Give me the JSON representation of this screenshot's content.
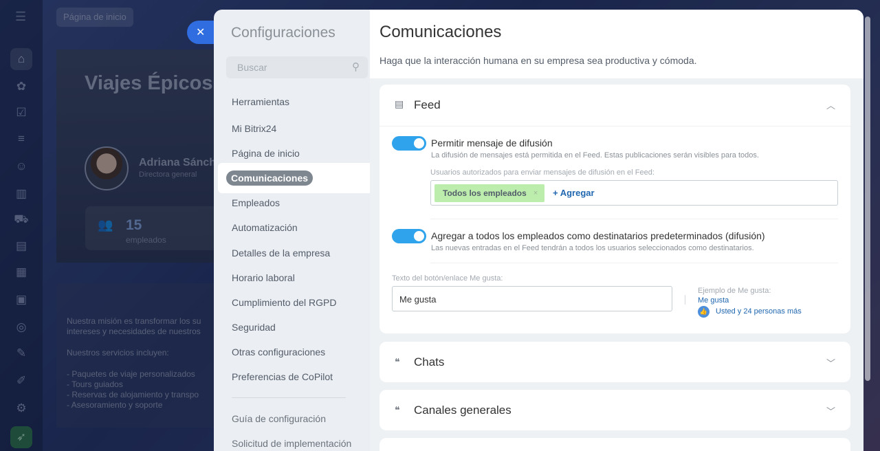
{
  "background": {
    "breadcrumb": "Página de inicio",
    "hero_title": "Viajes Épicos",
    "person_name": "Adriana Sánch",
    "person_role": "Directora general",
    "stat_number": "15",
    "stat_label": "empleados",
    "mission_lines": [
      "Nuestra misión es transformar los su",
      "intereses y necesidades de nuestros",
      "",
      "Nuestros servicios incluyen:",
      "",
      "- Paquetes de viaje personalizados",
      "- Tours guiados",
      "- Reservas de alojamiento y transpo",
      "- Asesoramiento y soporte"
    ],
    "rail_icons": [
      "home-icon",
      "puzzle-icon",
      "checkbox-icon",
      "filter-icon",
      "robot-icon",
      "bar-chart-icon",
      "cart-icon",
      "id-card-icon",
      "calendar-icon",
      "building-icon",
      "target-icon",
      "document-sign-icon",
      "pen-icon",
      "gear-icon",
      "rocket-icon"
    ]
  },
  "close_icon": "✕",
  "settings": {
    "title": "Configuraciones",
    "search_placeholder": "Buscar",
    "nav_items": [
      "Herramientas",
      "Mi Bitrix24",
      "Página de inicio",
      "Comunicaciones",
      "Empleados",
      "Automatización",
      "Detalles de la empresa",
      "Horario laboral",
      "Cumplimiento del RGPD",
      "Seguridad",
      "Otras configuraciones",
      "Preferencias de CoPilot"
    ],
    "nav_secondary": [
      "Guía de configuración",
      "Solicitud de implementación"
    ],
    "active_item": "Comunicaciones"
  },
  "content": {
    "title": "Comunicaciones",
    "subtitle": "Haga que la interacción humana en su empresa sea productiva y cómoda.",
    "feed": {
      "title": "Feed",
      "option1": {
        "title": "Permitir mensaje de difusión",
        "desc": "La difusión de mensajes está permitida en el Feed. Estas publicaciones serán visibles para todos.",
        "checked": true
      },
      "authorized_label": "Usuarios autorizados para enviar mensajes de difusión en el Feed:",
      "tag": "Todos los empleados",
      "tag_remove": "×",
      "add_label": "+ Agregar",
      "option2": {
        "title": "Agregar a todos los empleados como destinatarios predeterminados (difusión)",
        "desc": "Las nuevas entradas en el Feed tendrán a todos los usuarios seleccionados como destinatarios.",
        "checked": true
      },
      "like_label": "Texto del botón/enlace Me gusta:",
      "like_value": "Me gusta",
      "example_label": "Ejemplo de Me gusta:",
      "example_link": "Me gusta",
      "example_text": "Usted y 24 personas más"
    },
    "chats": {
      "title": "Chats"
    },
    "channels": {
      "title": "Canales generales"
    }
  },
  "colors": {
    "accent": "#2fa3ec",
    "link": "#2067b0",
    "tag_bg": "#bcedad",
    "close_button": "#2f6de0"
  }
}
